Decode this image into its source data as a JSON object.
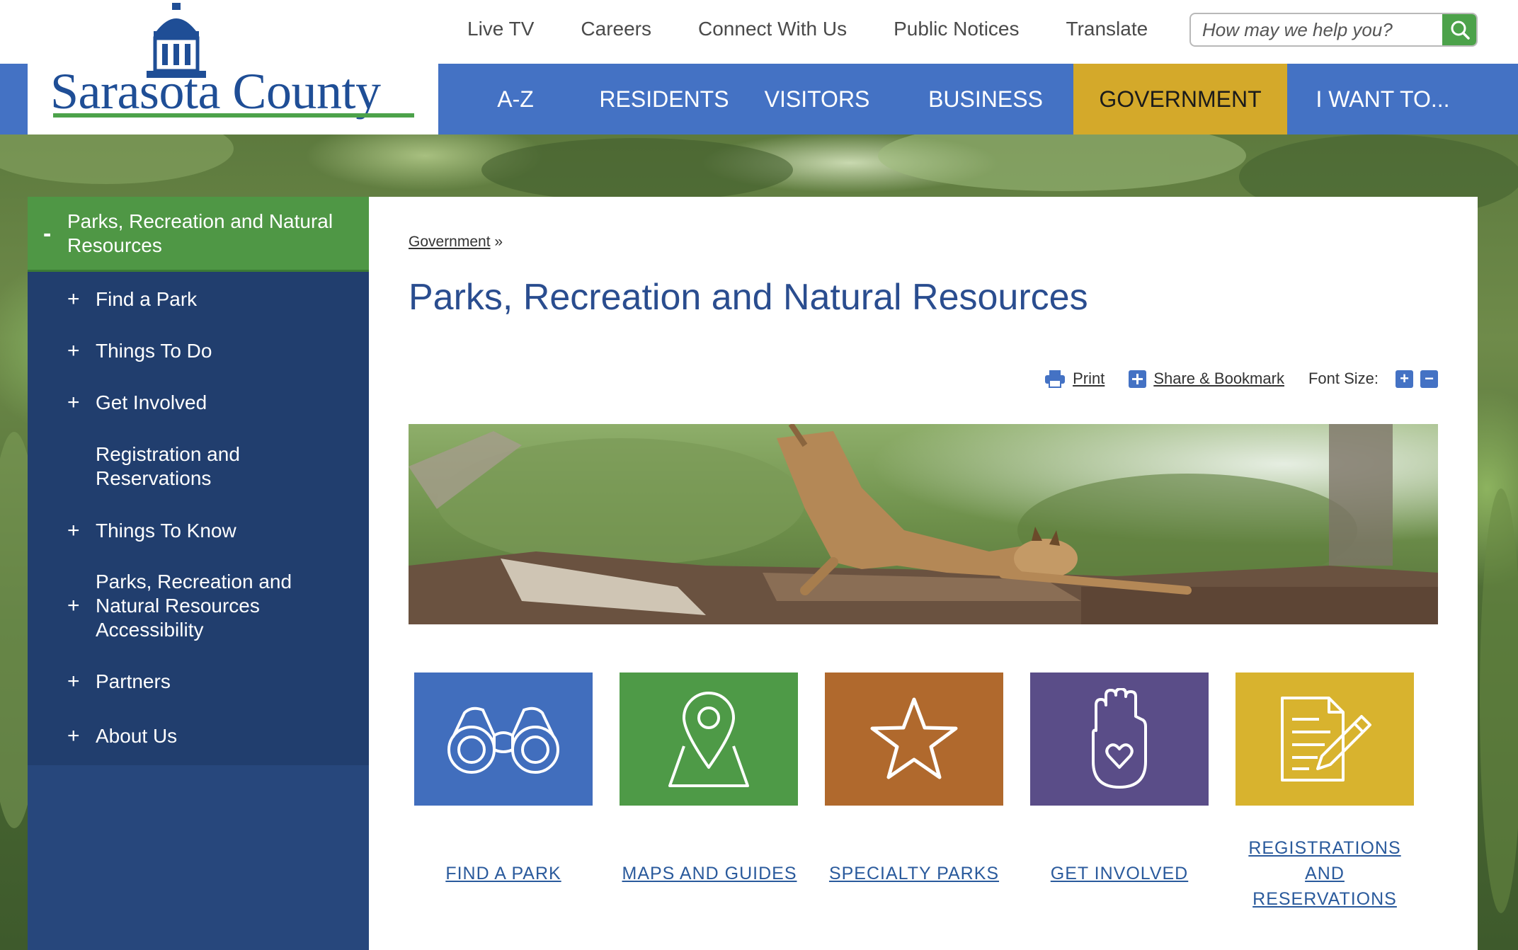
{
  "logo": {
    "text": "Sarasota County"
  },
  "utility_nav": [
    "Live TV",
    "Careers",
    "Connect With Us",
    "Public Notices",
    "Translate"
  ],
  "search": {
    "placeholder": "How may we help you?"
  },
  "main_nav": [
    {
      "label": "A-Z",
      "active": false
    },
    {
      "label": "RESIDENTS",
      "active": false
    },
    {
      "label": "VISITORS",
      "active": false
    },
    {
      "label": "BUSINESS",
      "active": false
    },
    {
      "label": "GOVERNMENT",
      "active": true
    },
    {
      "label": "I WANT TO...",
      "active": false
    }
  ],
  "sidebar": {
    "header": "Parks, Recreation and Natural Resources",
    "header_toggle": "-",
    "items": [
      {
        "label": "Find a Park",
        "toggle": "+"
      },
      {
        "label": "Things To Do",
        "toggle": "+"
      },
      {
        "label": "Get Involved",
        "toggle": "+"
      },
      {
        "label": "Registration and Reservations",
        "toggle": ""
      },
      {
        "label": "Things To Know",
        "toggle": "+"
      },
      {
        "label": "Parks, Recreation and Natural Resources Accessibility",
        "toggle": "+"
      },
      {
        "label": "Partners",
        "toggle": "+"
      },
      {
        "label": "About Us",
        "toggle": "+"
      }
    ]
  },
  "breadcrumb": {
    "link": "Government",
    "separator": "»"
  },
  "page_title": "Parks, Recreation and Natural Resources",
  "tools": {
    "print": "Print",
    "share": "Share & Bookmark",
    "font_size": "Font Size:",
    "increase": "+",
    "decrease": "−"
  },
  "tiles": [
    {
      "label": "FIND A PARK",
      "color": "#416ebd",
      "icon": "binoculars-icon"
    },
    {
      "label": "MAPS AND GUIDES",
      "color": "#4e9a47",
      "icon": "map-pin-icon"
    },
    {
      "label": "SPECIALTY PARKS",
      "color": "#b0692d",
      "icon": "star-icon"
    },
    {
      "label": "GET INVOLVED",
      "color": "#5a4d88",
      "icon": "hand-heart-icon"
    },
    {
      "label": "REGISTRATIONS AND RESERVATIONS",
      "color": "#d8b32e",
      "icon": "document-pencil-icon"
    }
  ],
  "colors": {
    "brand_blue": "#4472c4",
    "brand_green": "#4ca24a",
    "active_gold": "#d4a92a",
    "sidebar_navy": "#213e6e",
    "title_blue": "#2a4d8f"
  }
}
